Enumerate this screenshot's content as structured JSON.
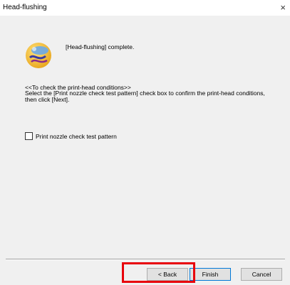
{
  "window": {
    "title": "Head-flushing",
    "close_glyph": "×"
  },
  "status": {
    "message": "[Head-flushing] complete."
  },
  "instructions": {
    "heading": "<<To check the print-head conditions>>",
    "body": "Select the [Print nozzle check test pattern] check box to confirm the print-head conditions, then click [Next]."
  },
  "option": {
    "label": "Print nozzle check test pattern",
    "checked": false
  },
  "buttons": {
    "back": "< Back",
    "finish": "Finish",
    "cancel": "Cancel"
  },
  "icons": {
    "app": "printer-head-flush-icon",
    "close": "close-icon"
  },
  "colors": {
    "highlight": "#e8000b",
    "focus": "#0078d7"
  }
}
